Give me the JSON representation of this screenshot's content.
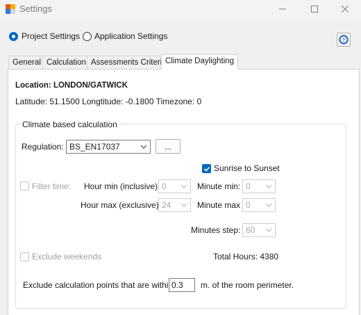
{
  "window": {
    "title": "Settings"
  },
  "mode_radios": {
    "project": "Project Settings",
    "application": "Application Settings"
  },
  "tabs": [
    {
      "label": "General"
    },
    {
      "label": "Calculation"
    },
    {
      "label": "Assessments Criteria"
    },
    {
      "label": "Climate Daylighting"
    }
  ],
  "location": {
    "label": "Location: LONDON/GATWICK",
    "coords": "Latitude: 51.1500 Longtitude: -0.1800 Timezone: 0"
  },
  "group": {
    "title": "Climate based calculation",
    "regulation_label": "Regulation:",
    "regulation_value": "BS_EN17037",
    "browse_label": "...",
    "sunrise_label": "Sunrise to Sunset",
    "filter_time_label": "Filter time:",
    "hour_min_label": "Hour min (inclusive):",
    "hour_min_value": "0",
    "minute_min_label": "Minute min:",
    "minute_min_value": "0",
    "hour_max_label": "Hour max (exclusive):",
    "hour_max_value": "24",
    "minute_max_label": "Minute max",
    "minute_max_value": "0",
    "minutes_step_label": "Minutes step:",
    "minutes_step_value": "60",
    "exclude_weekends_label": "Exclude weekends",
    "total_hours": "Total Hours: 4380",
    "exclude_points_prefix": "Exclude calculation points that are within",
    "exclude_points_value": "0.3",
    "exclude_points_suffix": "m. of the room perimeter."
  },
  "colors": {
    "accent": "#0067c0",
    "disabled_text": "#a0a0a0"
  }
}
